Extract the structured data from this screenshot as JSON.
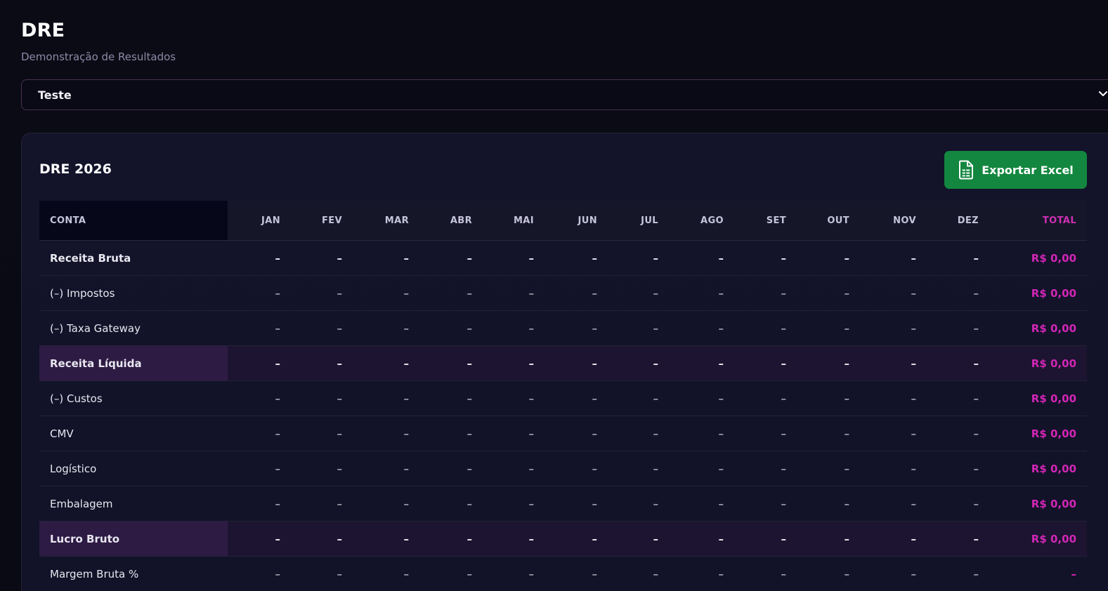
{
  "page": {
    "title": "DRE",
    "subtitle": "Demonstração de Resultados"
  },
  "company_select": {
    "value": "Teste",
    "icon": "chevron-down-icon"
  },
  "card": {
    "title": "DRE 2026",
    "export_label": "Exportar Excel",
    "export_icon": "spreadsheet-icon"
  },
  "table": {
    "headers": [
      "CONTA",
      "JAN",
      "FEV",
      "MAR",
      "ABR",
      "MAI",
      "JUN",
      "JUL",
      "AGO",
      "SET",
      "OUT",
      "NOV",
      "DEZ",
      "TOTAL"
    ],
    "rows": [
      {
        "label": "Receita Bruta",
        "values": [
          "–",
          "–",
          "–",
          "–",
          "–",
          "–",
          "–",
          "–",
          "–",
          "–",
          "–",
          "–"
        ],
        "total": "R$ 0,00"
      },
      {
        "label": "(–) Impostos",
        "values": [
          "–",
          "–",
          "–",
          "–",
          "–",
          "–",
          "–",
          "–",
          "–",
          "–",
          "–",
          "–"
        ],
        "total": "R$ 0,00"
      },
      {
        "label": "(–) Taxa Gateway",
        "values": [
          "–",
          "–",
          "–",
          "–",
          "–",
          "–",
          "–",
          "–",
          "–",
          "–",
          "–",
          "–"
        ],
        "total": "R$ 0,00"
      },
      {
        "label": "Receita Líquida",
        "values": [
          "–",
          "–",
          "–",
          "–",
          "–",
          "–",
          "–",
          "–",
          "–",
          "–",
          "–",
          "–"
        ],
        "total": "R$ 0,00"
      },
      {
        "label": "(–) Custos",
        "values": [
          "–",
          "–",
          "–",
          "–",
          "–",
          "–",
          "–",
          "–",
          "–",
          "–",
          "–",
          "–"
        ],
        "total": "R$ 0,00"
      },
      {
        "label": "CMV",
        "values": [
          "–",
          "–",
          "–",
          "–",
          "–",
          "–",
          "–",
          "–",
          "–",
          "–",
          "–",
          "–"
        ],
        "total": "R$ 0,00"
      },
      {
        "label": "Logístico",
        "values": [
          "–",
          "–",
          "–",
          "–",
          "–",
          "–",
          "–",
          "–",
          "–",
          "–",
          "–",
          "–"
        ],
        "total": "R$ 0,00"
      },
      {
        "label": "Embalagem",
        "values": [
          "–",
          "–",
          "–",
          "–",
          "–",
          "–",
          "–",
          "–",
          "–",
          "–",
          "–",
          "–"
        ],
        "total": "R$ 0,00"
      },
      {
        "label": "Lucro Bruto",
        "values": [
          "–",
          "–",
          "–",
          "–",
          "–",
          "–",
          "–",
          "–",
          "–",
          "–",
          "–",
          "–"
        ],
        "total": "R$ 0,00"
      },
      {
        "label": "Margem Bruta %",
        "values": [
          "–",
          "–",
          "–",
          "–",
          "–",
          "–",
          "–",
          "–",
          "–",
          "–",
          "–",
          "–"
        ],
        "total": "–"
      }
    ]
  },
  "colors": {
    "accent_total": "#d226b6",
    "export_button": "#13873f",
    "highlight_row": "#2e1b44"
  }
}
